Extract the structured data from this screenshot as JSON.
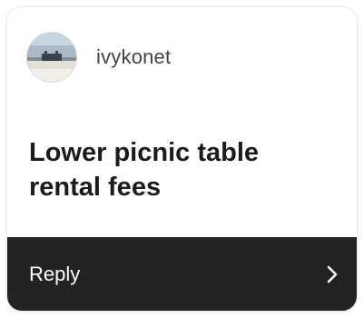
{
  "question_card": {
    "author": {
      "username": "ivykonet",
      "avatar_icon": "avatar-photo"
    },
    "question": "Lower picnic table rental fees",
    "reply": {
      "label": "Reply",
      "icon": "chevron-right-icon"
    }
  },
  "colors": {
    "card_background": "#ffffff",
    "question_text": "#1b1b1b",
    "username_text": "#444444",
    "reply_bar_background": "#232323",
    "reply_text": "#ffffff"
  }
}
